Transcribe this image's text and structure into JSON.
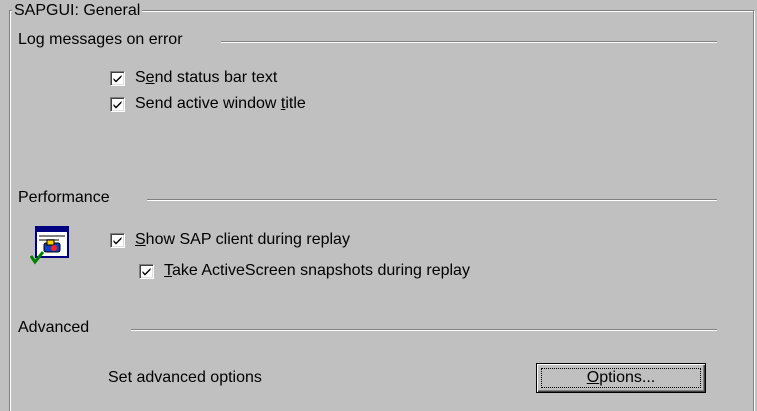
{
  "group": {
    "title": "SAPGUI: General"
  },
  "log_section": {
    "label": "Log messages on error",
    "send_status": {
      "pre": "S",
      "accel": "e",
      "post": "nd status bar text",
      "checked": true
    },
    "send_title": {
      "pre": "Send active window ",
      "accel": "t",
      "post": "itle",
      "checked": true
    }
  },
  "performance_section": {
    "label": "Performance",
    "icon": "sap-client-icon",
    "show_client": {
      "pre": "",
      "accel": "S",
      "post": "how SAP client during replay",
      "checked": true
    },
    "take_snapshots": {
      "pre": "",
      "accel": "T",
      "post": "ake ActiveScreen snapshots during replay",
      "checked": true
    }
  },
  "advanced_section": {
    "label": "Advanced",
    "description": "Set advanced options",
    "options_button": {
      "pre": "",
      "accel": "O",
      "post": "ptions..."
    }
  },
  "colors": {
    "background": "#c0c0c0",
    "shadow": "#808080",
    "highlight": "#ffffff"
  }
}
